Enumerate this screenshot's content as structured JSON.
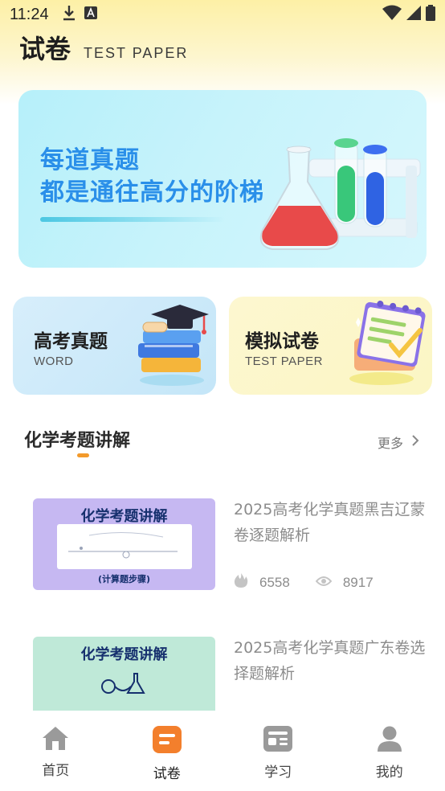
{
  "status": {
    "time": "11:24"
  },
  "header": {
    "title": "试卷",
    "subtitle": "TEST PAPER"
  },
  "banner": {
    "line1": "每道真题",
    "line2": "都是通往高分的阶梯"
  },
  "categories": [
    {
      "title": "高考真题",
      "subtitle": "WORD"
    },
    {
      "title": "模拟试卷",
      "subtitle": "TEST PAPER"
    }
  ],
  "section": {
    "title": "化学考题讲解",
    "more": "更多"
  },
  "articles": [
    {
      "thumb_title": "化学考题讲解",
      "thumb_caption": "(计算题步骤)",
      "title": "2025高考化学真题黑吉辽蒙卷逐题解析",
      "likes": "6558",
      "views": "8917"
    },
    {
      "thumb_title": "化学考题讲解",
      "title": "2025高考化学真题广东卷选择题解析"
    }
  ],
  "tabs": [
    {
      "label": "首页",
      "icon": "home-icon"
    },
    {
      "label": "试卷",
      "icon": "paper-icon",
      "active": true
    },
    {
      "label": "学习",
      "icon": "study-icon"
    },
    {
      "label": "我的",
      "icon": "profile-icon"
    }
  ],
  "colors": {
    "accent": "#f39a2b",
    "banner_text": "#2a8fe9",
    "muted": "#8c8c8c"
  }
}
